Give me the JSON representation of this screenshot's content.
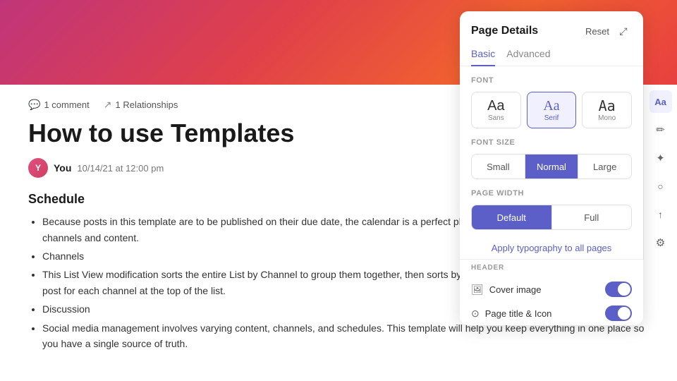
{
  "page": {
    "header_gradient": "linear-gradient(135deg, #c0357a 0%, #e0404a 40%, #f06030 70%, #e84040 100%)"
  },
  "meta": {
    "comment_count": "1 comment",
    "relationships_count": "1 Relationships"
  },
  "document": {
    "title": "How to use Templates",
    "author": "You",
    "date": "10/14/21 at 12:00 pm",
    "section_heading": "Schedule",
    "bullets": [
      "Because posts in this template are to be published on their due date, the calendar is a perfect place to manage publication dates for all channels and content.",
      "Channels",
      "This List View modification sorts the entire List by Channel to group them together, then sorts by due date so you can see the upcoming post for each channel at the top of the list.",
      "Discussion",
      "Social media management involves varying content, channels, and schedules. This template will help you keep everything in one place so you have a single source of truth."
    ]
  },
  "panel": {
    "title": "Page Details",
    "reset_label": "Reset",
    "expand_icon": "⤢",
    "tabs": [
      {
        "id": "basic",
        "label": "Basic",
        "active": true
      },
      {
        "id": "advanced",
        "label": "Advanced",
        "active": false
      }
    ],
    "font_section": {
      "label": "Font",
      "options": [
        {
          "id": "sans",
          "display": "Aa",
          "label": "Sans",
          "selected": false
        },
        {
          "id": "serif",
          "display": "Aa",
          "label": "Serif",
          "selected": true
        },
        {
          "id": "mono",
          "display": "Aa",
          "label": "Mono",
          "selected": false
        }
      ]
    },
    "font_size_section": {
      "label": "Font Size",
      "options": [
        {
          "id": "small",
          "label": "Small",
          "selected": false
        },
        {
          "id": "normal",
          "label": "Normal",
          "selected": true
        },
        {
          "id": "large",
          "label": "Large",
          "selected": false
        }
      ]
    },
    "page_width_section": {
      "label": "Page Width",
      "options": [
        {
          "id": "default",
          "label": "Default",
          "selected": true
        },
        {
          "id": "full",
          "label": "Full",
          "selected": false
        }
      ]
    },
    "apply_typography_label": "Apply typography to all pages",
    "header_section_label": "HEADER",
    "header_items": [
      {
        "id": "cover-image",
        "icon": "🖼",
        "label": "Cover image",
        "enabled": true
      },
      {
        "id": "page-title-icon",
        "icon": "⊙",
        "label": "Page title & Icon",
        "enabled": true
      }
    ]
  },
  "sidebar_icons": [
    {
      "id": "font-aa",
      "symbol": "Aa",
      "active": true
    },
    {
      "id": "edit",
      "symbol": "✏",
      "active": false
    },
    {
      "id": "settings",
      "symbol": "⚙",
      "active": false
    },
    {
      "id": "search",
      "symbol": "○",
      "active": false
    },
    {
      "id": "share",
      "symbol": "↑",
      "active": false
    },
    {
      "id": "gear",
      "symbol": "⚙",
      "active": false
    }
  ]
}
